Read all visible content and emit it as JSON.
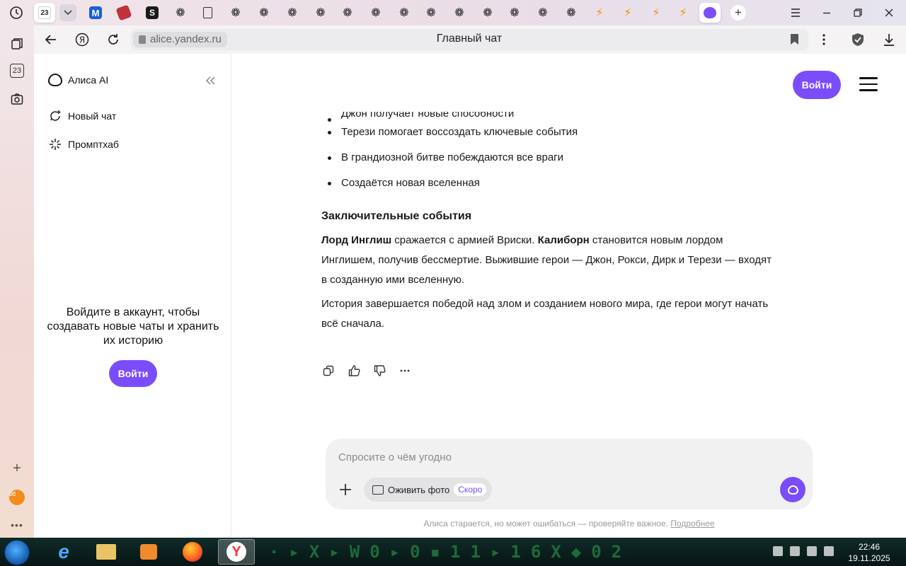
{
  "browser": {
    "calendar_tab": "23",
    "address": "alice.yandex.ru",
    "page_title": "Главный чат",
    "sidebar_calendar": "23"
  },
  "alice": {
    "brand": "Алиса AI",
    "menu": [
      {
        "label": "Новый чат",
        "icon": "new-chat-icon"
      },
      {
        "label": "Промптхаб",
        "icon": "sparkle-icon"
      }
    ],
    "login_prompt": "Войдите в аккаунт, чтобы создавать новые чаты и хранить их историю",
    "login_button": "Войти",
    "header_login_button": "Войти",
    "answer": {
      "bullets": [
        "Джон получает новые способности",
        "Терези помогает воссоздать ключевые события",
        "В грандиозной битве побеждаются все враги",
        "Создаётся новая вселенная"
      ],
      "section_heading": "Заключительные события",
      "paragraph1": {
        "b1": "Лорд Инглиш",
        "t1": " сражается с армией Вриски. ",
        "b2": "Калиборн",
        "t2": " становится новым лордом Инглишем, получив бессмертие. Выжившие герои — Джон, Рокси, Дирк и Терези — входят в созданную ими вселенную."
      },
      "paragraph2": "История завершается победой над злом и созданием нового мира, где герои могут начать всё сначала."
    },
    "composer": {
      "placeholder": "Спросите о чём угодно",
      "revive_label": "Оживить фото",
      "soon_badge": "Скоро"
    },
    "disclaimer": "Алиса старается, но может ошибаться — проверяйте важное.",
    "disclaimer_link": "Подробнее",
    "accent_color": "#7b4dfa"
  },
  "taskbar": {
    "time": "22:46",
    "date": "19.11.2025"
  }
}
